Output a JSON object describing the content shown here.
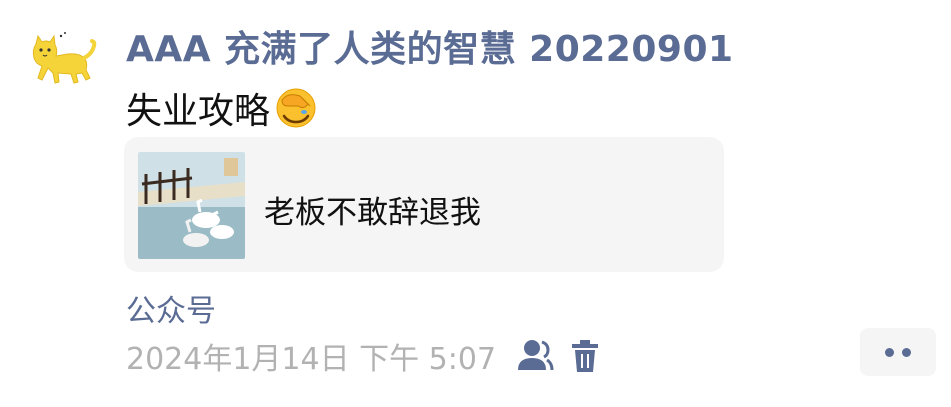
{
  "post": {
    "author": "AAA 充满了人类的智慧 20220901",
    "text": "失业攻略",
    "emoji": "facepalm-emoji"
  },
  "shared_card": {
    "title": "老板不敢辞退我",
    "thumbnail": "geese-fence-illustration"
  },
  "source_label": "公众号",
  "meta": {
    "timestamp": "2024年1月14日 下午 5:07",
    "visibility_icon": "friends-icon",
    "delete_icon": "trash-icon"
  },
  "actions": {
    "more_icon": "more-dots-icon"
  },
  "colors": {
    "link": "#5a6b94",
    "muted": "#b2b2b2",
    "card_bg": "#f5f5f5",
    "text": "#111111"
  }
}
